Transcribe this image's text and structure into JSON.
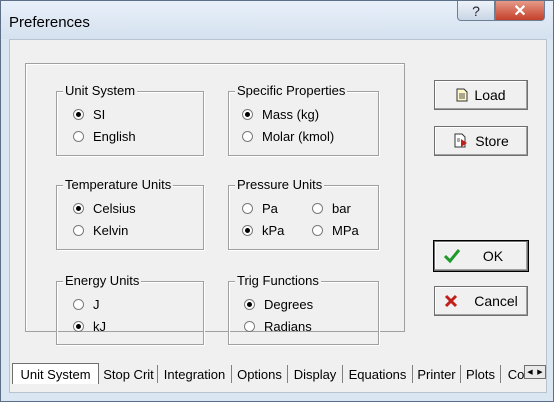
{
  "window": {
    "title": "Preferences",
    "help_glyph": "?",
    "close_glyph": "✕"
  },
  "groups": {
    "unit_system": {
      "title": "Unit System",
      "options": [
        "SI",
        "English"
      ],
      "selected": "SI"
    },
    "specific_properties": {
      "title": "Specific Properties",
      "options": [
        "Mass (kg)",
        "Molar (kmol)"
      ],
      "selected": "Mass (kg)"
    },
    "temperature_units": {
      "title": "Temperature Units",
      "options": [
        "Celsius",
        "Kelvin"
      ],
      "selected": "Celsius"
    },
    "pressure_units": {
      "title": "Pressure Units",
      "options": [
        "Pa",
        "bar",
        "kPa",
        "MPa"
      ],
      "selected": "kPa"
    },
    "energy_units": {
      "title": "Energy Units",
      "options": [
        "J",
        "kJ"
      ],
      "selected": "kJ"
    },
    "trig_functions": {
      "title": "Trig Functions",
      "options": [
        "Degrees",
        "Radians"
      ],
      "selected": "Degrees"
    }
  },
  "buttons": {
    "load": "Load",
    "store": "Store",
    "ok": "OK",
    "cancel": "Cancel"
  },
  "icons": {
    "ok": "check-icon",
    "cancel": "x-icon",
    "load": "document-icon",
    "store": "save-icon"
  },
  "colors": {
    "ok_check": "#1f9a2a",
    "cancel_x": "#c0201a"
  },
  "tabs": [
    "Unit System",
    "Stop Crit",
    "Integration",
    "Options",
    "Display",
    "Equations",
    "Printer",
    "Plots",
    "Co"
  ],
  "active_tab": "Unit System"
}
